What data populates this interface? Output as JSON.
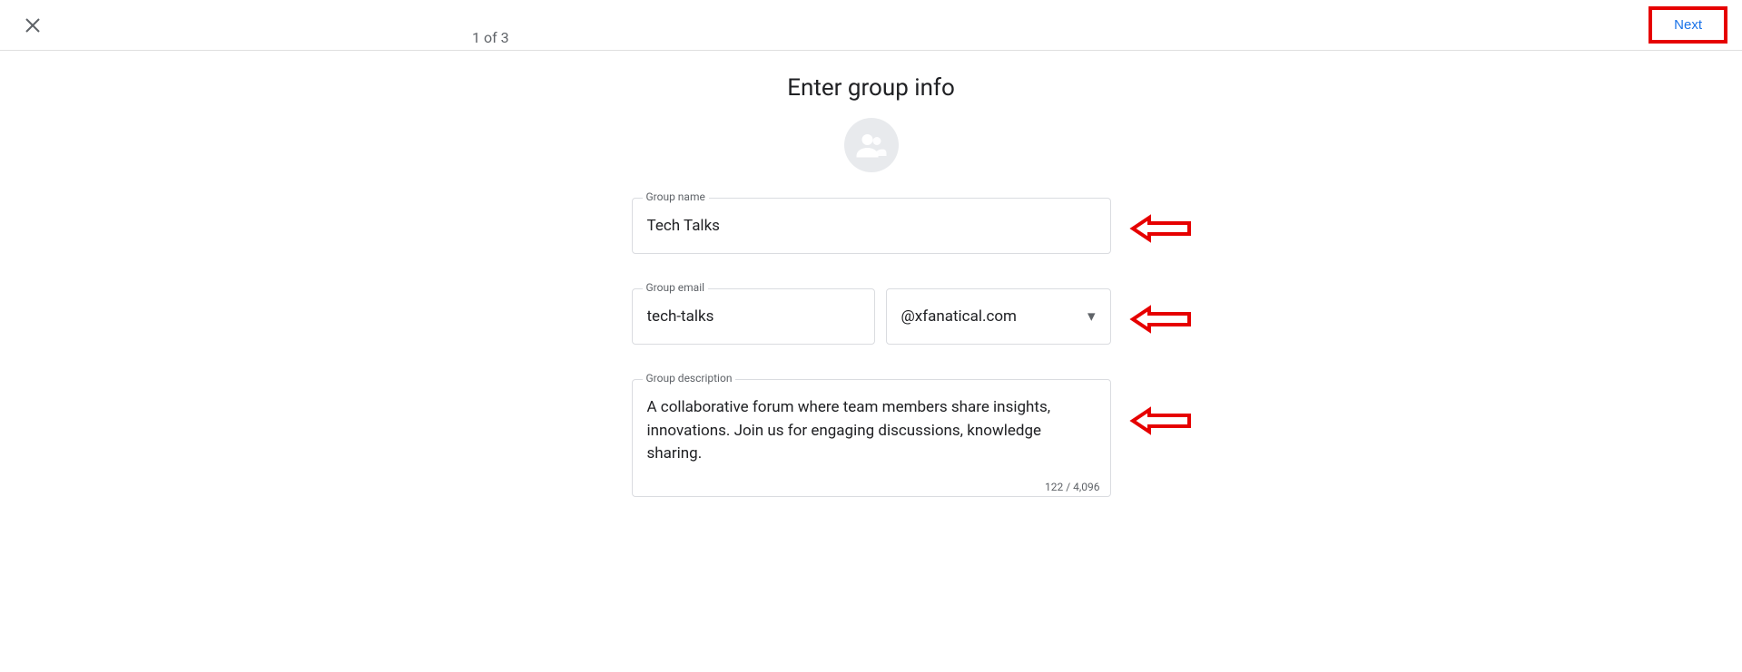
{
  "header": {
    "step_indicator": "1 of 3",
    "next_label": "Next"
  },
  "page": {
    "title": "Enter group info"
  },
  "form": {
    "group_name": {
      "label": "Group name",
      "value": "Tech Talks"
    },
    "group_email": {
      "label": "Group email",
      "value": "tech-talks",
      "domain": "@xfanatical.com"
    },
    "group_description": {
      "label": "Group description",
      "value": "A collaborative forum where team members share insights, innovations. Join us for engaging discussions, knowledge sharing.",
      "char_count": "122 / 4,096"
    }
  },
  "annotations": {
    "highlight_color": "#e60000"
  }
}
